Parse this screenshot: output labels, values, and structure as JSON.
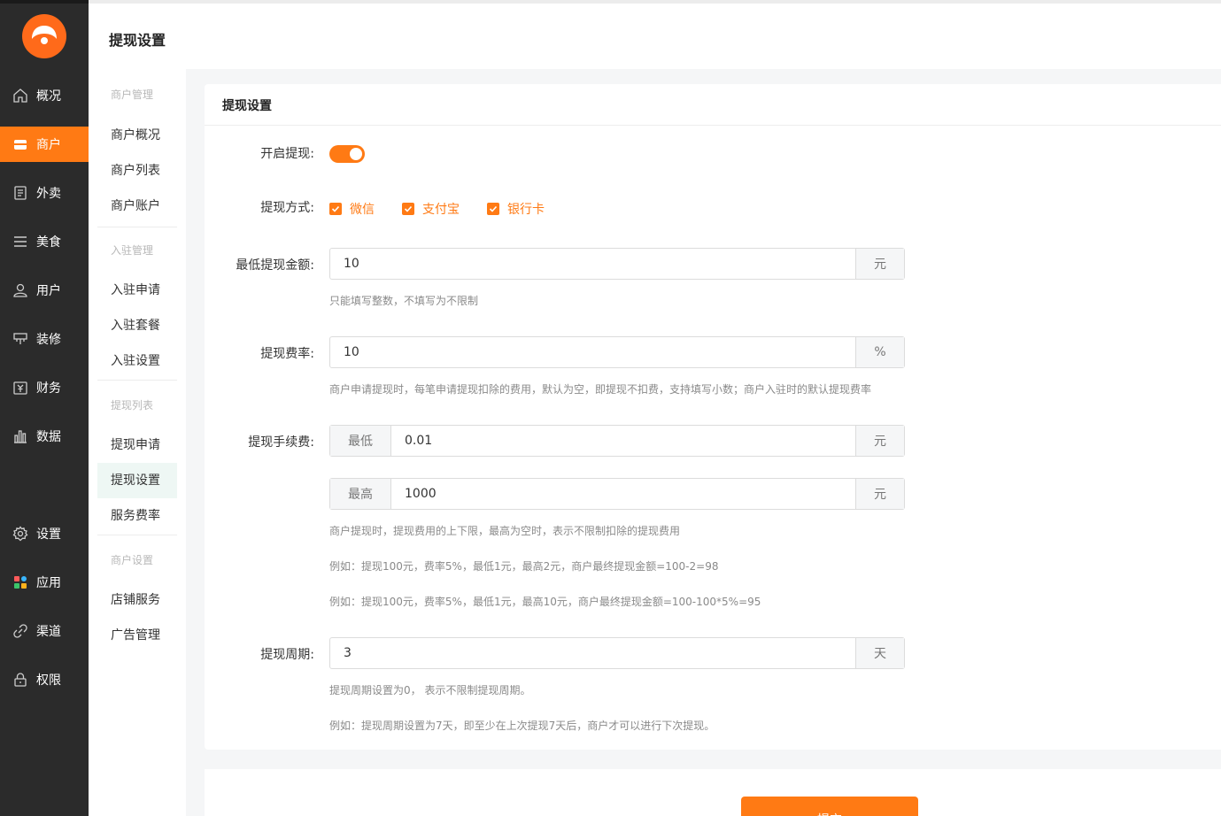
{
  "sidebar": {
    "items": [
      {
        "label": "概况",
        "icon": "home-icon"
      },
      {
        "label": "商户",
        "icon": "store-icon"
      },
      {
        "label": "外卖",
        "icon": "document-icon"
      },
      {
        "label": "美食",
        "icon": "list-icon"
      },
      {
        "label": "用户",
        "icon": "user-icon"
      },
      {
        "label": "装修",
        "icon": "brush-icon"
      },
      {
        "label": "财务",
        "icon": "yuan-icon"
      },
      {
        "label": "数据",
        "icon": "bar-chart-icon"
      },
      {
        "label": "设置",
        "icon": "gear-icon"
      },
      {
        "label": "应用",
        "icon": "apps-icon"
      },
      {
        "label": "渠道",
        "icon": "link-icon"
      },
      {
        "label": "权限",
        "icon": "lock-icon"
      }
    ],
    "active_color": "#ff7a14"
  },
  "submenu": {
    "group1": "商户管理",
    "items1": [
      "商户概况",
      "商户列表",
      "商户账户"
    ],
    "group2": "入驻管理",
    "items2": [
      "入驻申请",
      "入驻套餐",
      "入驻设置"
    ],
    "group3": "提现列表",
    "items3": [
      "提现申请",
      "提现设置",
      "服务费率"
    ],
    "group4": "商户设置",
    "items4": [
      "店铺服务",
      "广告管理"
    ]
  },
  "header": {
    "title": "提现设置"
  },
  "card": {
    "title": "提现设置"
  },
  "form": {
    "enable": {
      "label": "开启提现:",
      "on": true
    },
    "method": {
      "label": "提现方式:",
      "options": [
        "微信",
        "支付宝",
        "银行卡"
      ]
    },
    "min_amount": {
      "label": "最低提现金额:",
      "value": "10",
      "unit": "元",
      "hint": "只能填写整数，不填写为不限制"
    },
    "rate": {
      "label": "提现费率:",
      "value": "10",
      "unit": "%",
      "hint": "商户申请提现时，每笔申请提现扣除的费用，默认为空，即提现不扣费，支持填写小数；商户入驻时的默认提现费率"
    },
    "fee": {
      "label": "提现手续费:",
      "min_prefix": "最低",
      "min_value": "0.01",
      "min_unit": "元",
      "max_prefix": "最高",
      "max_value": "1000",
      "max_unit": "元",
      "hint1": "商户提现时，提现费用的上下限，最高为空时，表示不限制扣除的提现费用",
      "hint2": "例如：提现100元，费率5%，最低1元，最高2元，商户最终提现金额=100-2=98",
      "hint3": "例如：提现100元，费率5%，最低1元，最高10元，商户最终提现金额=100-100*5%=95"
    },
    "period": {
      "label": "提现周期:",
      "value": "3",
      "unit": "天",
      "hint1": "提现周期设置为0， 表示不限制提现周期。",
      "hint2": "例如：提现周期设置为7天，即至少在上次提现7天后，商户才可以进行下次提现。"
    }
  },
  "submit_label": "提交"
}
